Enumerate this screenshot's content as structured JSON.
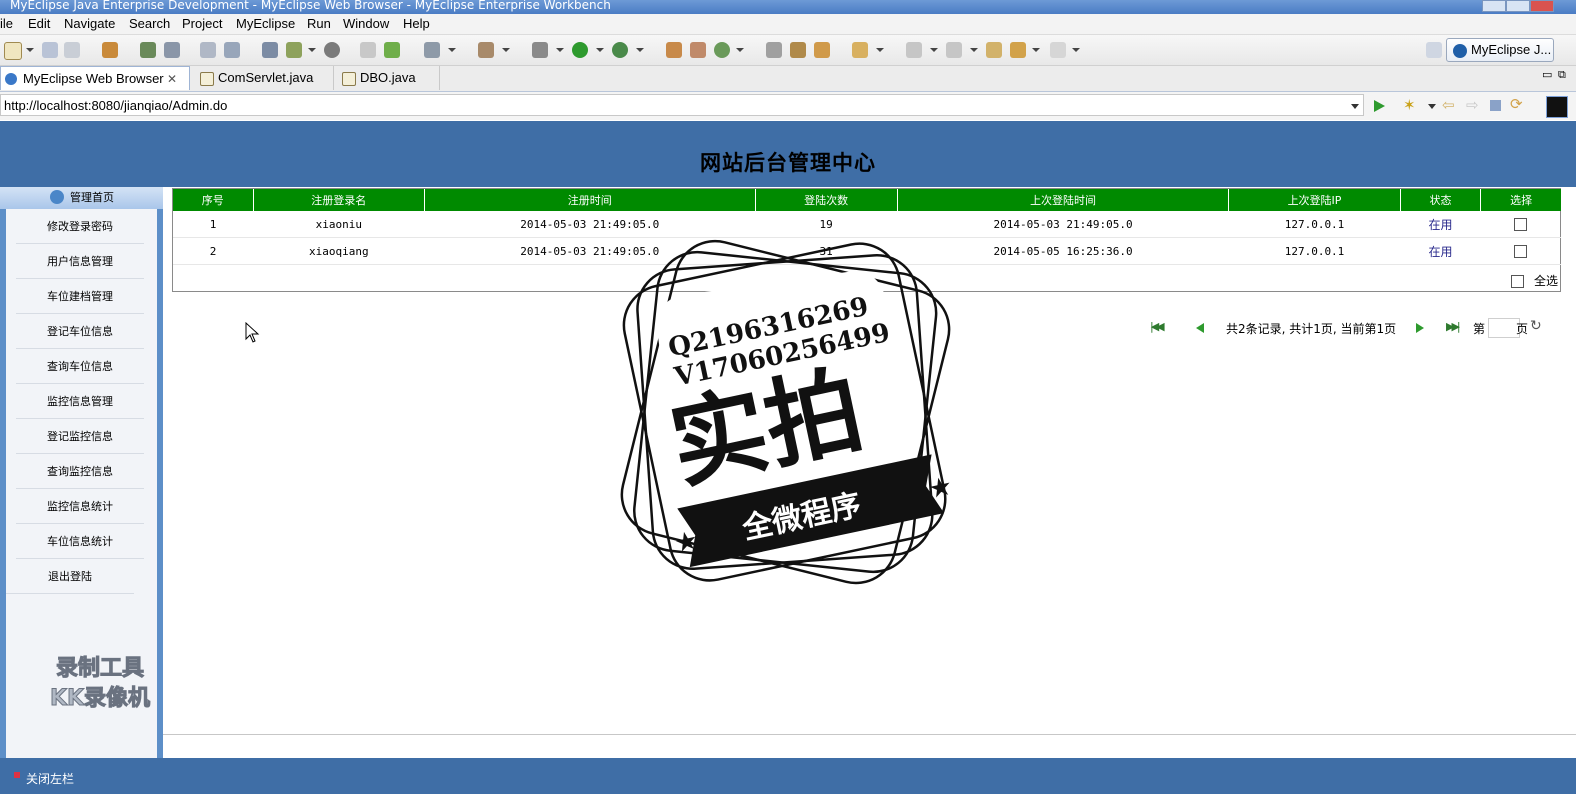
{
  "window": {
    "title": "MyEclipse Java Enterprise Development - MyEclipse Web Browser - MyEclipse Enterprise Workbench"
  },
  "menu": [
    "File",
    "Edit",
    "Navigate",
    "Search",
    "Project",
    "MyEclipse",
    "Run",
    "Window",
    "Help"
  ],
  "menu_display_first": "ile",
  "toolbar": {
    "perspective_label": "MyEclipse J..."
  },
  "tabs": [
    {
      "label": "MyEclipse Web Browser",
      "active": true
    },
    {
      "label": "ComServlet.java",
      "active": false
    },
    {
      "label": "DBO.java",
      "active": false
    }
  ],
  "browser": {
    "url": "http://localhost:8080/jianqiao/Admin.do"
  },
  "page": {
    "title": "网站后台管理中心",
    "sidebar_header": "管理首页",
    "nav": [
      "修改登录密码",
      "用户信息管理",
      "车位建档管理",
      "登记车位信息",
      "查询车位信息",
      "监控信息管理",
      "登记监控信息",
      "查询监控信息",
      "监控信息统计",
      "车位信息统计",
      "退出登陆"
    ],
    "table": {
      "headers": [
        "序号",
        "注册登录名",
        "注册时间",
        "登陆次数",
        "上次登陆时间",
        "上次登陆IP",
        "状态",
        "选择"
      ],
      "rows": [
        [
          "1",
          "xiaoniu",
          "2014-05-03 21:49:05.0",
          "19",
          "2014-05-03 21:49:05.0",
          "127.0.0.1",
          "在用"
        ],
        [
          "2",
          "xiaoqiang",
          "2014-05-03 21:49:05.0",
          "31",
          "2014-05-05 16:25:36.0",
          "127.0.0.1",
          "在用"
        ]
      ],
      "select_all": "全选"
    },
    "pager": {
      "summary": "共2条记录, 共计1页, 当前第1页",
      "page_prefix": "第",
      "page_suffix": "页"
    },
    "footer_toggle": "关闭左栏"
  },
  "watermark": {
    "line1": "Q2196316269",
    "line2": "V17060256499",
    "big": "实拍",
    "banner": "全微程序",
    "rec1": "录制工具",
    "rec2": "KK录像机"
  },
  "colors": {
    "header_blue": "#3f6ea6",
    "table_header_green": "#008a00",
    "status_text": "#2a2a8c"
  }
}
